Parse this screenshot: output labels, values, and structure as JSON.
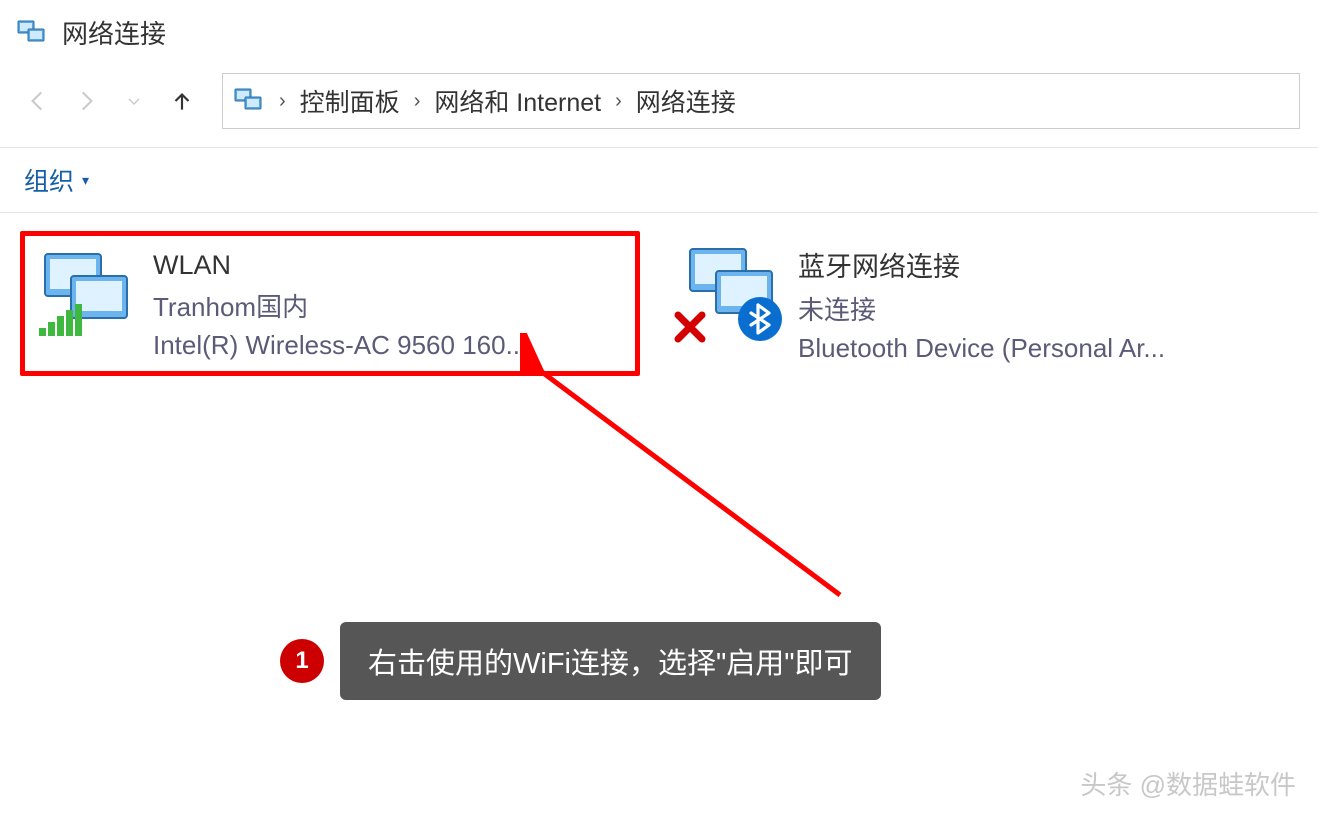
{
  "window": {
    "title": "网络连接"
  },
  "breadcrumbs": {
    "c0": "控制面板",
    "c1": "网络和 Internet",
    "c2": "网络连接"
  },
  "toolbar": {
    "organize": "组织"
  },
  "connections": {
    "wlan": {
      "title": "WLAN",
      "sub": "Tranhom国内",
      "device": "Intel(R) Wireless-AC 9560 160..."
    },
    "bt": {
      "title": "蓝牙网络连接",
      "sub": "未连接",
      "device": "Bluetooth Device (Personal Ar..."
    }
  },
  "annotation": {
    "step": "1",
    "tip": "右击使用的WiFi连接，选择\"启用\"即可"
  },
  "watermark": "头条 @数据蛙软件"
}
